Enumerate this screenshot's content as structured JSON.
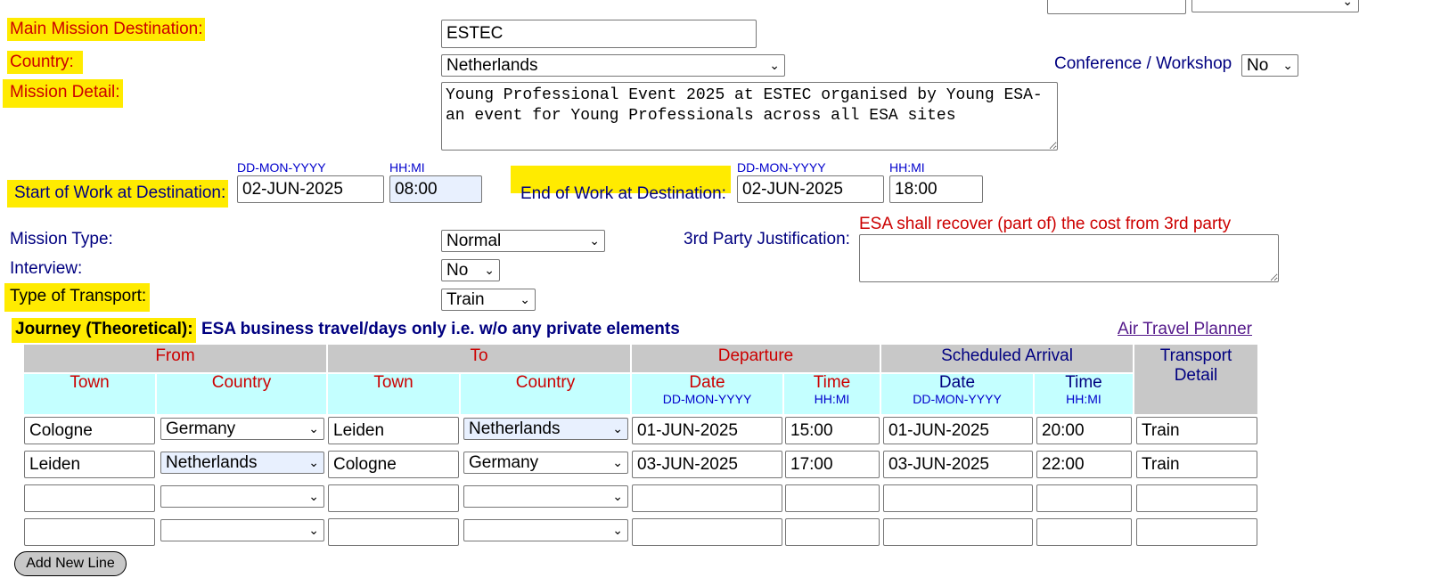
{
  "header": {
    "main_destination_label": "Main Mission Destination:",
    "main_destination_value": "ESTEC",
    "country_label": "Country:",
    "country_value": "Netherlands",
    "conference_label": "Conference / Workshop",
    "conference_value": "No",
    "mission_detail_label": "Mission Detail:",
    "mission_detail_value": "Young Professional Event 2025 at ESTEC organised by Young ESA-an event for Young Professionals across all ESA sites"
  },
  "work": {
    "date_hint": "DD-MON-YYYY",
    "time_hint": "HH:MI",
    "start_label": "Start of Work at Destination:",
    "start_date": "02-JUN-2025",
    "start_time": "08:00",
    "end_label": "End of Work at Destination:",
    "end_date": "02-JUN-2025",
    "end_time": "18:00"
  },
  "mission": {
    "type_label": "Mission Type:",
    "type_value": "Normal",
    "interview_label": "Interview:",
    "interview_value": "No",
    "transport_label": "Type of Transport:",
    "transport_value": "Train",
    "third_party_label": "3rd Party Justification:",
    "third_party_note": "ESA shall recover (part of) the cost from 3rd party",
    "third_party_value": ""
  },
  "journey": {
    "label": "Journey (Theoretical):",
    "note": "ESA business travel/days only i.e. w/o any private elements",
    "air_planner_link": "Air Travel Planner",
    "groups": {
      "from": "From",
      "to": "To",
      "departure": "Departure",
      "arrival": "Scheduled Arrival",
      "transport": "Transport Detail"
    },
    "cols": {
      "town": "Town",
      "country": "Country",
      "date": "Date",
      "time": "Time",
      "date_hint": "DD-MON-YYYY",
      "time_hint": "HH:MI"
    },
    "rows": [
      {
        "from_town": "Cologne",
        "from_country": "Germany",
        "to_town": "Leiden",
        "to_country": "Netherlands",
        "dep_date": "01-JUN-2025",
        "dep_time": "15:00",
        "arr_date": "01-JUN-2025",
        "arr_time": "20:00",
        "transport": "Train"
      },
      {
        "from_town": "Leiden",
        "from_country": "Netherlands",
        "to_town": "Cologne",
        "to_country": "Germany",
        "dep_date": "03-JUN-2025",
        "dep_time": "17:00",
        "arr_date": "03-JUN-2025",
        "arr_time": "22:00",
        "transport": "Train"
      },
      {
        "from_town": "",
        "from_country": "",
        "to_town": "",
        "to_country": "",
        "dep_date": "",
        "dep_time": "",
        "arr_date": "",
        "arr_time": "",
        "transport": ""
      },
      {
        "from_town": "",
        "from_country": "",
        "to_town": "",
        "to_country": "",
        "dep_date": "",
        "dep_time": "",
        "arr_date": "",
        "arr_time": "",
        "transport": ""
      }
    ],
    "add_line_button": "Add New Line"
  },
  "colors": {
    "highlight": "#ffeb00",
    "label_red": "#cc0000",
    "label_navy": "#000080",
    "header_grey": "#c8c8c8",
    "header_cyan": "#c4ffff",
    "autofill_blue": "#e8f0fe"
  }
}
